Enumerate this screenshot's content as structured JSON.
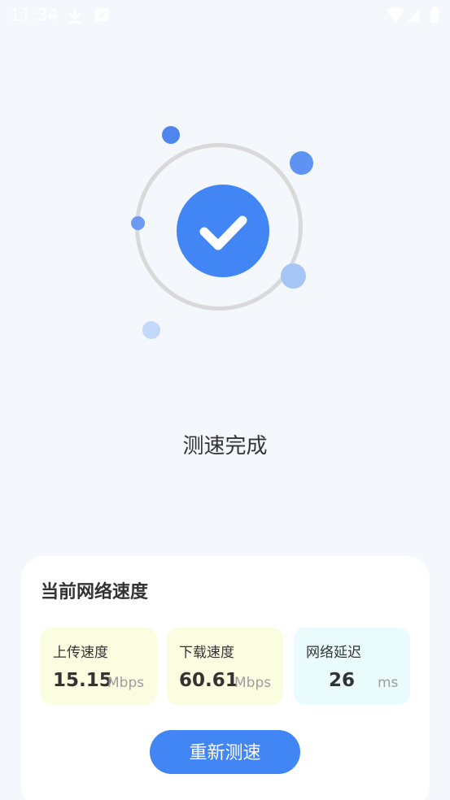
{
  "status_bar": {
    "time": "11:34",
    "icons": [
      "download-icon",
      "screenshot-icon",
      "wifi-icon",
      "signal-icon",
      "battery-icon"
    ]
  },
  "result": {
    "title": "测速完成",
    "icon": "check-icon"
  },
  "card": {
    "title": "当前网络速度",
    "metrics": [
      {
        "label": "上传速度",
        "value": "15.15",
        "unit": "Mbps",
        "bg": "#fafde0"
      },
      {
        "label": "下载速度",
        "value": "60.61",
        "unit": "Mbps",
        "bg": "#fafde0"
      },
      {
        "label": "网络延迟",
        "value": "26",
        "unit": "ms",
        "bg": "#e9fbfb"
      }
    ],
    "button_label": "重新测速"
  },
  "colors": {
    "accent": "#4285f4",
    "background": "#f4f7fb",
    "ring": "#d9d9d9"
  }
}
